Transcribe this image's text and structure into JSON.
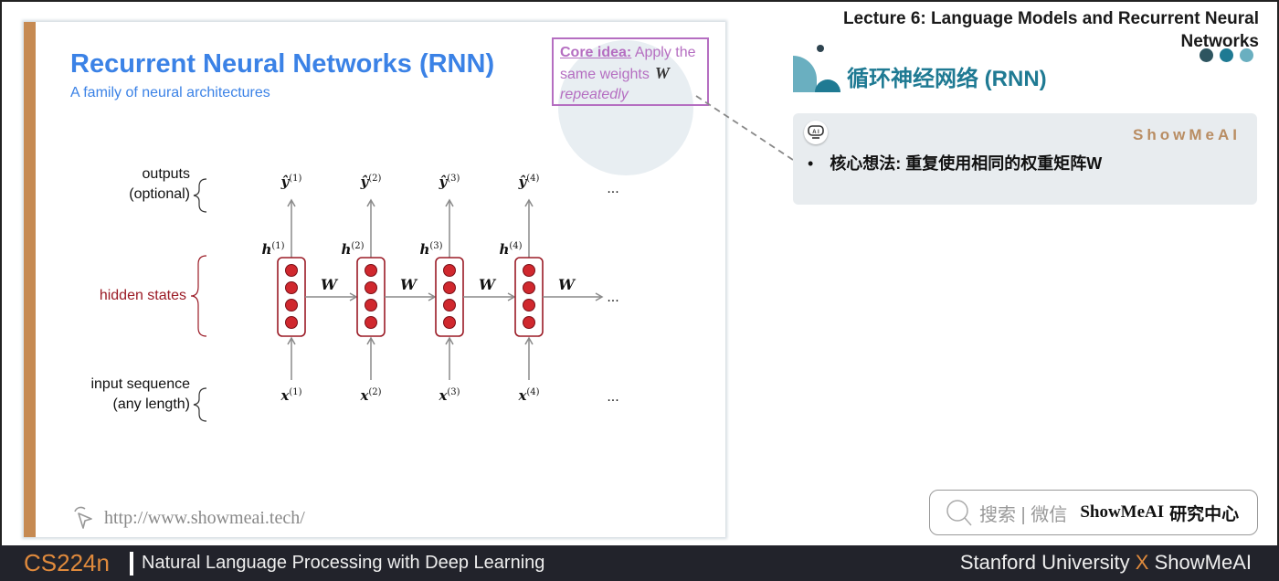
{
  "slide": {
    "title": "Recurrent Neural Networks (RNN)",
    "subtitle": "A family of neural architectures",
    "core_idea": {
      "lead": "Core idea:",
      "text1": " Apply the same weights",
      "symbol": "W",
      "text2": "repeatedly"
    },
    "labels": {
      "outputs_line1": "outputs",
      "outputs_line2": "(optional)",
      "hidden": "hidden states",
      "input_line1": "input sequence",
      "input_line2": "(any length)"
    },
    "diagram": {
      "steps": [
        {
          "y": "ŷ",
          "h": "h",
          "x": "x",
          "index": "(1)"
        },
        {
          "y": "ŷ",
          "h": "h",
          "x": "x",
          "index": "(2)"
        },
        {
          "y": "ŷ",
          "h": "h",
          "x": "x",
          "index": "(3)"
        },
        {
          "y": "ŷ",
          "h": "h",
          "x": "x",
          "index": "(4)"
        }
      ],
      "weight_label": "W",
      "ellipsis": "...",
      "units_per_state": 4
    },
    "url": "http://www.showmeai.tech/"
  },
  "panel": {
    "lecture_title": "Lecture 6:  Language Models and Recurrent Neural Networks",
    "section_heading": "循环神经网络 (RNN)",
    "brand_tag": "ShowMeAI",
    "notes": [
      "核心想法: 重复使用相同的权重矩阵W"
    ],
    "dots_colors": [
      "#2e5560",
      "#1f7a93",
      "#6aafc0"
    ]
  },
  "search": {
    "hint": "搜索 | 微信",
    "brand": "ShowMeAI",
    "brand_cn": "研究中心"
  },
  "footer": {
    "course_code": "CS224n",
    "course_name": "Natural Language Processing with Deep Learning",
    "partner_left": "Stanford University",
    "partner_x": "X",
    "partner_right": "ShowMeAI"
  },
  "colors": {
    "title_blue": "#3b82e6",
    "accent_orange": "#c68a52",
    "core_purple": "#b56ec1",
    "hidden_red": "#9b1b26",
    "node_red": "#d0282e",
    "teal": "#1f7a93"
  }
}
